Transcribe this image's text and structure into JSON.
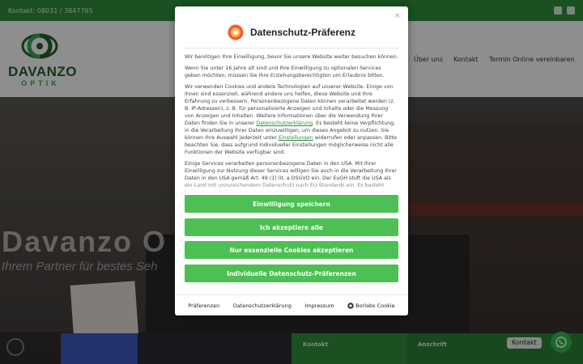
{
  "topbar": {
    "phone": "Kontakt: 08031 / 3847765"
  },
  "logo": {
    "brand": "DAVANZO",
    "sub": "OPTIK"
  },
  "nav": [
    "Über uns",
    "Kontakt",
    "Termin Online vereinbaren"
  ],
  "hero": {
    "title": "Davanzo O",
    "tagline": "Ihrem Partner für bestes Seh"
  },
  "bottom": {
    "kontakt": "Kontakt",
    "anschrift": "Anschrift"
  },
  "whatsapp": {
    "label": "Kontakt"
  },
  "modal": {
    "close": "×",
    "title": "Datenschutz-Präferenz",
    "p1": "Wir benötigen Ihre Einwilligung, bevor Sie unsere Website weiter besuchen können.",
    "p2": "Wenn Sie unter 16 Jahre alt sind und Ihre Einwilligung zu optionalen Services geben möchten, müssen Sie Ihre Erziehungsberechtigten um Erlaubnis bitten.",
    "p3_a": "Wir verwenden Cookies und andere Technologien auf unserer Website. Einige von ihnen sind essenziell, während andere uns helfen, diese Website und Ihre Erfahrung zu verbessern. Personenbezogene Daten können verarbeitet werden (z. B. IP-Adressen), z. B. für personalisierte Anzeigen und Inhalte oder die Messung von Anzeigen und Inhalten. Weitere Informationen über die Verwendung Ihrer Daten finden Sie in unserer",
    "p3_link1": "Datenschutzerklärung",
    "p3_b": ". Es besteht keine Verpflichtung, in die Verarbeitung Ihrer Daten einzuwilligen, um dieses Angebot zu nutzen. Sie können Ihre Auswahl jederzeit unter",
    "p3_link2": "Einstellungen",
    "p3_c": "widerrufen oder anpassen. Bitte beachten Sie, dass aufgrund individueller Einstellungen möglicherweise nicht alle Funktionen der Website verfügbar sind.",
    "p4": "Einige Services verarbeiten personenbezogene Daten in den USA. Mit Ihrer Einwilligung zur Nutzung dieser Services willigen Sie auch in die Verarbeitung Ihrer Daten in den USA gemäß Art. 49 (1) lit. a DSGVO ein. Der EuGH stuft die USA als ein Land mit unzureichendem Datenschutz nach EU-Standards ein. Es besteht beispielsweise die Gefahr, dass US-Behörden personenbezogene Daten in Überwachungsprogrammen",
    "buttons": {
      "save": "Einwilligung speichern",
      "accept_all": "Ich akzeptiere alle",
      "essential": "Nur essenzielle Cookies akzeptieren",
      "individual": "Individuelle Datenschutz-Präferenzen"
    },
    "footer": {
      "prefs": "Präferenzen",
      "privacy": "Datenschutzerklärung",
      "imprint": "Impressum",
      "borlabs": "Borlabs Cookie"
    }
  },
  "colors": {
    "brand_green": "#2e8b3c",
    "button_green": "#4cc052",
    "brand_dark": "#1f5d2c"
  }
}
